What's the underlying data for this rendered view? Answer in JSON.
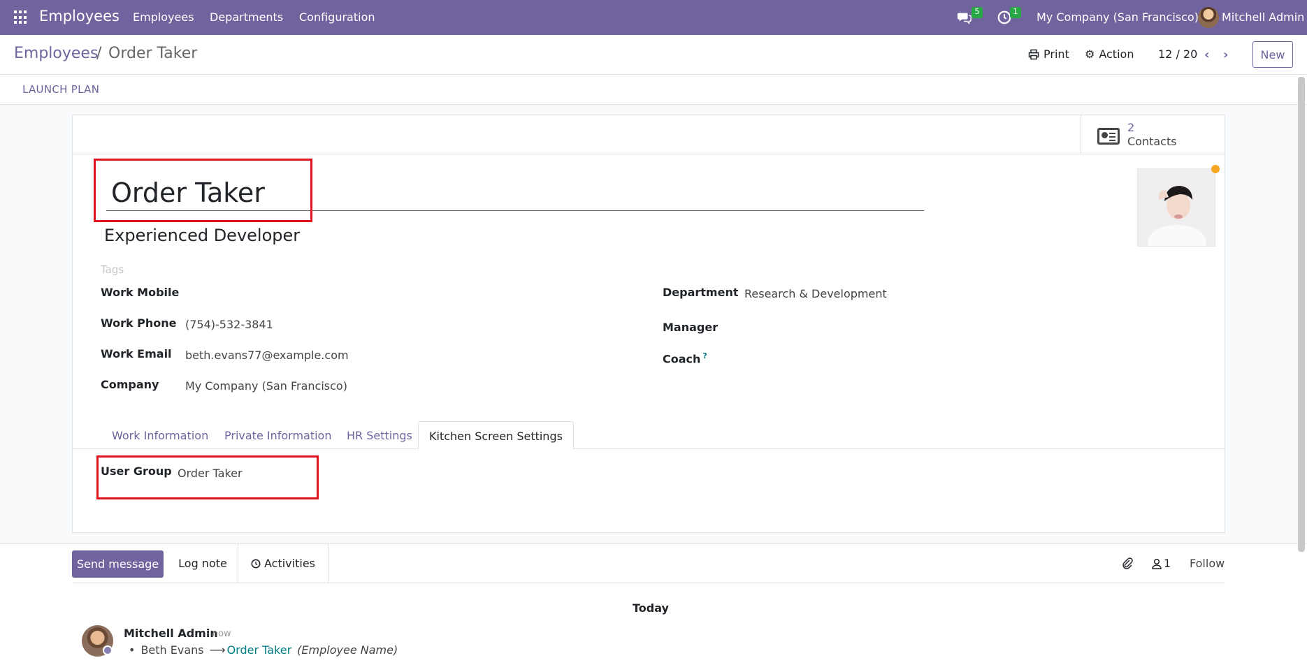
{
  "navbar": {
    "app_name": "Employees",
    "menu": [
      "Employees",
      "Departments",
      "Configuration"
    ],
    "messages_badge": "5",
    "activities_badge": "1",
    "company": "My Company (San Francisco)",
    "user": "Mitchell Admin"
  },
  "control": {
    "breadcrumb_root": "Employees",
    "breadcrumb_sep": "/",
    "breadcrumb_current": "Order Taker",
    "print_label": "Print",
    "action_label": "Action",
    "pager": "12 / 20",
    "new_label": "New"
  },
  "statusbar": {
    "launch_plan": "LAUNCH PLAN"
  },
  "form": {
    "smart_button": {
      "count": "2",
      "label": "Contacts"
    },
    "name": "Order Taker",
    "job_title": "Experienced Developer",
    "tags_placeholder": "Tags",
    "left_fields": [
      {
        "label": "Work Mobile",
        "value": ""
      },
      {
        "label": "Work Phone",
        "value": "(754)-532-3841"
      },
      {
        "label": "Work Email",
        "value": "beth.evans77@example.com"
      },
      {
        "label": "Company",
        "value": "My Company (San Francisco)"
      }
    ],
    "right_fields": [
      {
        "label": "Department",
        "value": "Research & Development"
      },
      {
        "label": "Manager",
        "value": ""
      },
      {
        "label": "Coach",
        "value": "",
        "help": "?"
      }
    ],
    "tabs": [
      "Work Information",
      "Private Information",
      "HR Settings",
      "Kitchen Screen Settings"
    ],
    "active_tab": "Kitchen Screen Settings",
    "user_group_label": "User Group",
    "user_group_value": "Order Taker"
  },
  "chatter": {
    "send_message": "Send message",
    "log_note": "Log note",
    "activities": "Activities",
    "followers_count": "1",
    "follow": "Follow",
    "date_separator": "Today",
    "message": {
      "author": "Mitchell Admin",
      "time": "- now",
      "old_value": "Beth Evans",
      "arrow": "⟶",
      "new_value": "Order Taker",
      "field": "(Employee Name)"
    }
  },
  "colors": {
    "brand": "#71639e",
    "highlight": "#e0141e",
    "badge": "#28a745",
    "status_dot": "#f5a623"
  }
}
